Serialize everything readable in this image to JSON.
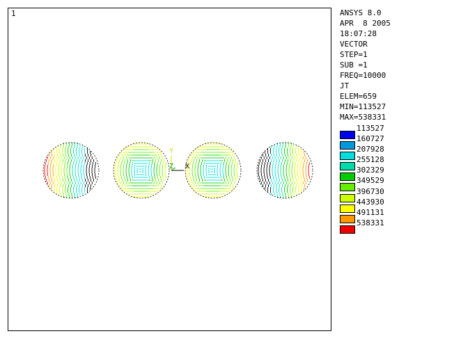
{
  "window": {
    "number": "1"
  },
  "info": {
    "lines": [
      "ANSYS 8.0",
      "APR  8 2005",
      "18:07:28",
      "VECTOR",
      "STEP=1",
      "SUB =1",
      "FREQ=10000",
      "JT",
      "ELEM=659",
      "MIN=113527",
      "MAX=538331"
    ]
  },
  "legend": {
    "values": [
      "113527",
      "160727",
      "207928",
      "255128",
      "302329",
      "349529",
      "396730",
      "443930",
      "491131",
      "538331"
    ],
    "colors": [
      "#0000ee",
      "#0099dd",
      "#00dddd",
      "#00ddaa",
      "#00cc00",
      "#66ee00",
      "#ccff00",
      "#ffff00",
      "#ff9900",
      "#ee0000"
    ]
  },
  "triad": {
    "x_label": "X",
    "y_label": "Y",
    "z_label": "Z"
  },
  "spheres": [
    {
      "name": "sphere-1",
      "pattern": "left-hot"
    },
    {
      "name": "sphere-2",
      "pattern": "ring"
    },
    {
      "name": "sphere-3",
      "pattern": "ring"
    },
    {
      "name": "sphere-4",
      "pattern": "right-hot"
    }
  ]
}
